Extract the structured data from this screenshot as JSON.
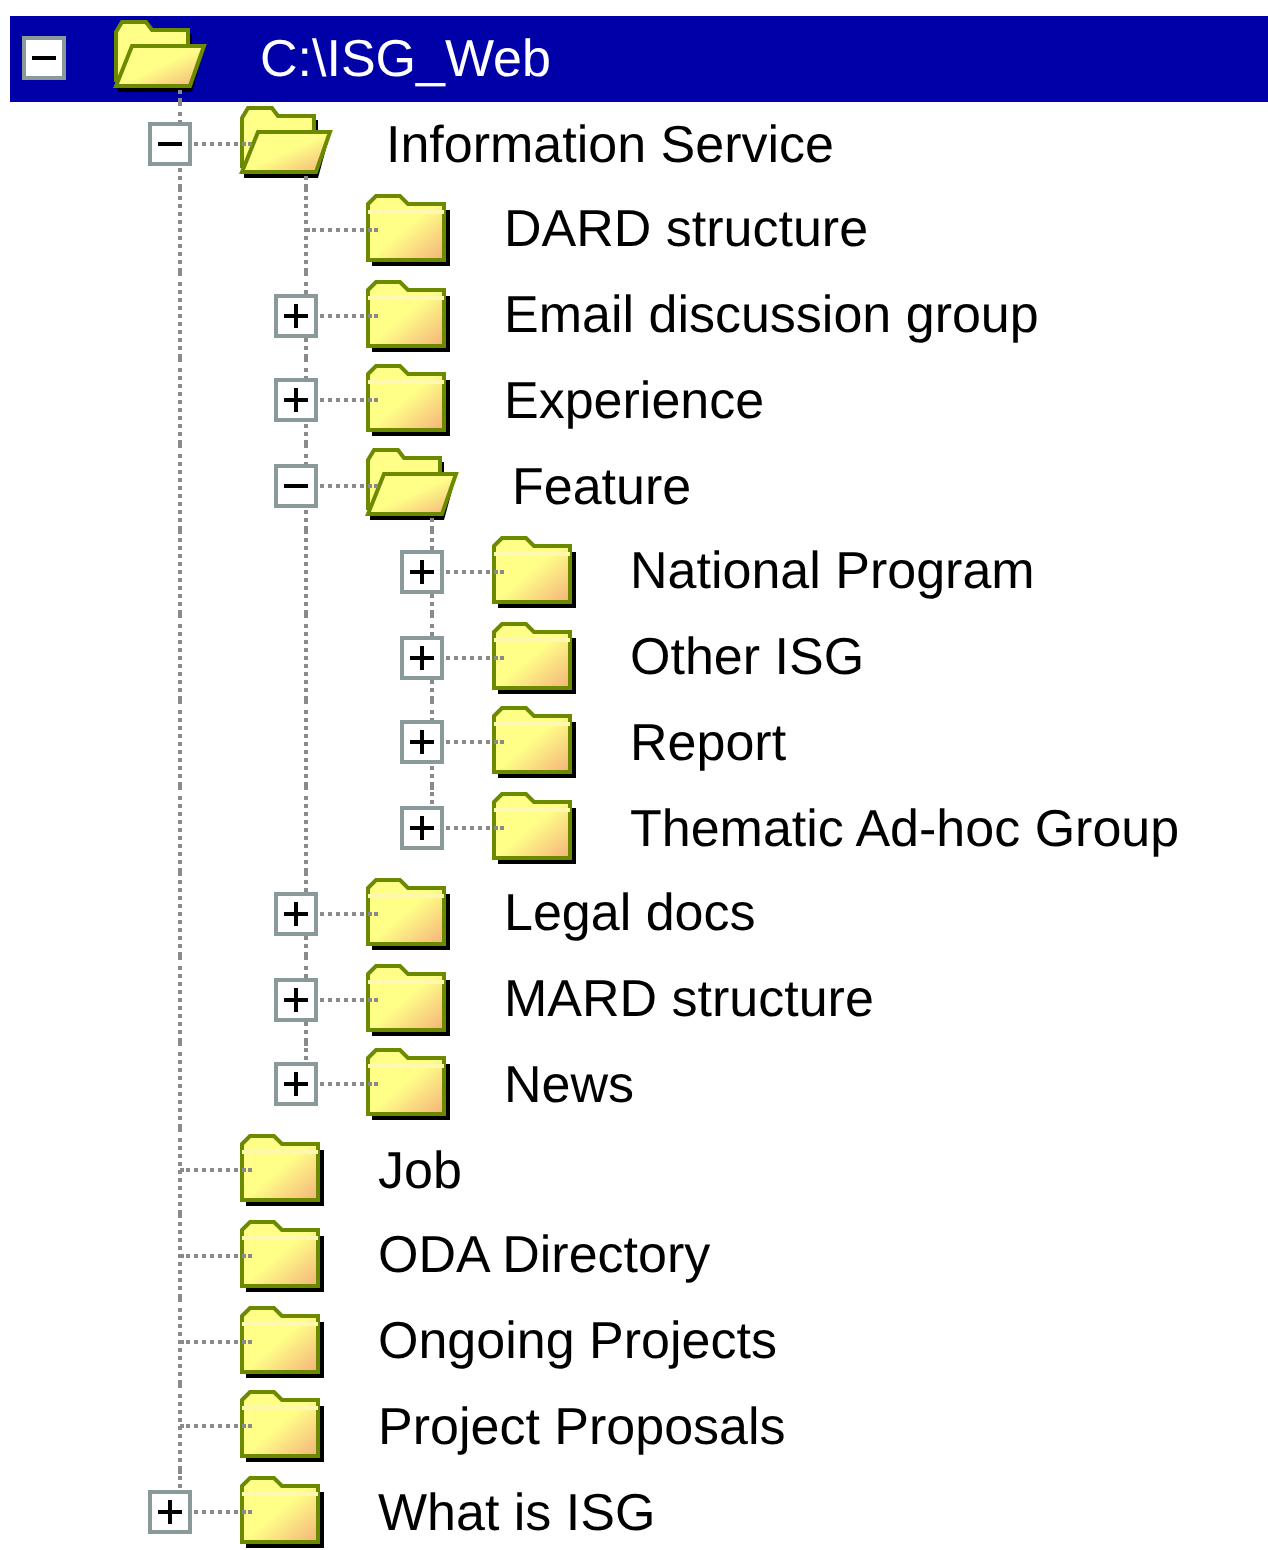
{
  "tree": [
    {
      "label": "C:\\ISG_Web",
      "kind": "branch",
      "expanded": true,
      "selected": true,
      "children": [
        {
          "label": "Information Service",
          "kind": "branch",
          "expanded": true,
          "selected": false,
          "children": [
            {
              "label": "DARD structure",
              "kind": "leaf",
              "selected": false
            },
            {
              "label": "Email discussion group",
              "kind": "branch",
              "expanded": false,
              "selected": false
            },
            {
              "label": "Experience",
              "kind": "branch",
              "expanded": false,
              "selected": false
            },
            {
              "label": "Feature",
              "kind": "branch",
              "expanded": true,
              "selected": false,
              "children": [
                {
                  "label": "National Program",
                  "kind": "branch",
                  "expanded": false,
                  "selected": false
                },
                {
                  "label": "Other ISG",
                  "kind": "branch",
                  "expanded": false,
                  "selected": false
                },
                {
                  "label": "Report",
                  "kind": "branch",
                  "expanded": false,
                  "selected": false
                },
                {
                  "label": "Thematic Ad-hoc Group",
                  "kind": "branch",
                  "expanded": false,
                  "selected": false
                }
              ]
            },
            {
              "label": "Legal docs",
              "kind": "branch",
              "expanded": false,
              "selected": false
            },
            {
              "label": "MARD structure",
              "kind": "branch",
              "expanded": false,
              "selected": false
            },
            {
              "label": "News",
              "kind": "branch",
              "expanded": false,
              "selected": false
            }
          ]
        },
        {
          "label": "Job",
          "kind": "leaf",
          "selected": false
        },
        {
          "label": "ODA Directory",
          "kind": "leaf",
          "selected": false
        },
        {
          "label": "Ongoing Projects",
          "kind": "leaf",
          "selected": false
        },
        {
          "label": "Project Proposals",
          "kind": "leaf",
          "selected": false
        },
        {
          "label": "What is ISG",
          "kind": "branch",
          "expanded": false,
          "selected": false
        }
      ]
    }
  ]
}
